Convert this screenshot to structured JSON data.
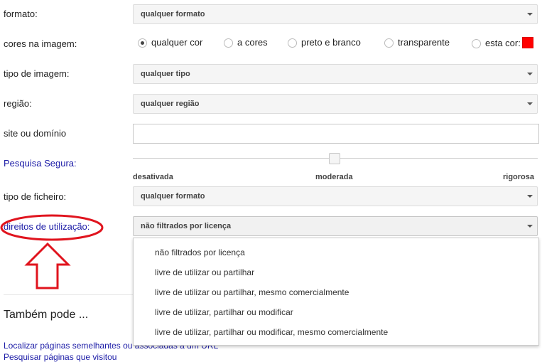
{
  "form": {
    "formato": {
      "label": "formato:",
      "value": "qualquer formato"
    },
    "cores": {
      "label": "cores na imagem:",
      "options": [
        "qualquer cor",
        "a cores",
        "preto e branco",
        "transparente",
        "esta cor:"
      ],
      "selected": "qualquer cor",
      "swatch_color": "#ff0000"
    },
    "tipo_imagem": {
      "label": "tipo de imagem:",
      "value": "qualquer tipo"
    },
    "regiao": {
      "label": "região:",
      "value": "qualquer região"
    },
    "site": {
      "label": "site ou domínio",
      "value": ""
    },
    "pesquisa_segura": {
      "label": "Pesquisa Segura:",
      "levels": [
        "desativada",
        "moderada",
        "rigorosa"
      ],
      "current": "moderada"
    },
    "tipo_ficheiro": {
      "label": "tipo de ficheiro:",
      "value": "qualquer formato"
    },
    "direitos": {
      "label": "direitos de utilização:",
      "value": "não filtrados por licença",
      "options": [
        "não filtrados por licença",
        "livre de utilizar ou partilhar",
        "livre de utilizar ou partilhar, mesmo comercialmente",
        "livre de utilizar, partilhar ou modificar",
        "livre de utilizar, partilhar ou modificar, mesmo comercialmente"
      ]
    }
  },
  "annotation": {
    "color": "#e0141e"
  },
  "also": {
    "heading": "Também pode ...",
    "links": [
      "Localizar páginas semelhantes ou associadas a um URL",
      "Pesquisar páginas que visitou"
    ]
  }
}
